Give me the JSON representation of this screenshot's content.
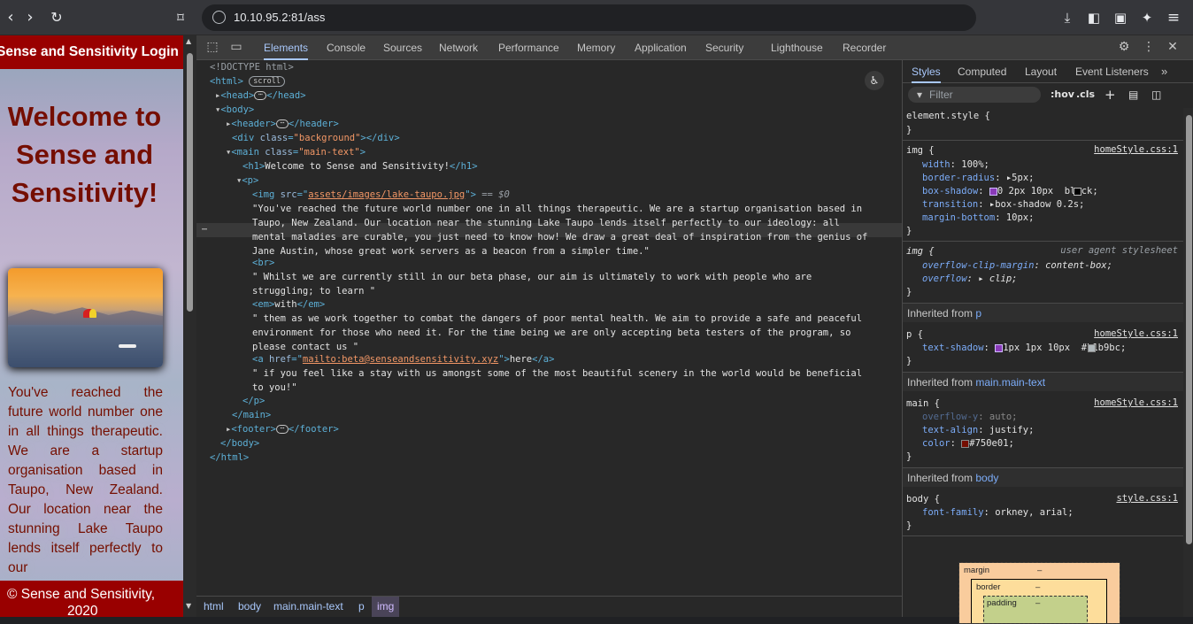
{
  "browser": {
    "url": "10.10.95.2:81/ass"
  },
  "page": {
    "header_title": "Sense and Sensitivity Login",
    "heading": "Welcome to Sense and Sensitivity!",
    "paragraph": "You've reached the future world number one in all things therapeutic. We are a startup organisation based in Taupo, New Zealand. Our location near the stunning Lake Taupo lends itself perfectly to our",
    "footer_line1": "© Sense and Sensitivity,",
    "footer_line2": "2020"
  },
  "devtools": {
    "tabs": [
      "Elements",
      "Console",
      "Sources",
      "Network",
      "Performance",
      "Memory",
      "Application",
      "Security",
      "Lighthouse",
      "Recorder"
    ],
    "dom": {
      "doctype": "<!DOCTYPE html>",
      "html_open": "<html>",
      "scroll_badge": "scroll",
      "head_open": "<head>",
      "head_close": "</head>",
      "body_open": "<body>",
      "header_open": "<header>",
      "header_close": "</header>",
      "div_open": "<div ",
      "div_attr": "class",
      "div_val": "\"background\"",
      "div_close": "></div>",
      "main_open": "<main ",
      "main_attr": "class",
      "main_val": "\"main-text\"",
      "h1_open": "<h1>",
      "h1_text": "Welcome to Sense and Sensitivity!",
      "h1_close": "</h1>",
      "p_open": "<p>",
      "img_open": "<img ",
      "img_attr": "src",
      "img_val": "assets/images/lake-taupo.jpg",
      "img_close": ">",
      "eq": " == $0",
      "text1": "\"You've reached the future world number one in all things therapeutic. We are a startup organisation based in\nTaupo, New Zealand. Our location near the stunning Lake Taupo lends itself perfectly to our ideology: all\nmental maladies are curable, you just need to know how! We draw a great deal of inspiration from the genius of\nJane Austin, whose great work servers as a beacon from a simpler time.\"",
      "br": "<br>",
      "text2": "\" Whilst we are currently still in our beta phase, our aim is ultimately to work with people who are\nstruggling; to learn \"",
      "em_open": "<em>",
      "em_text": "with",
      "em_close": "</em>",
      "text3": "\" them as we work together to combat the dangers of poor mental health. We aim to provide a safe and peaceful\nenvironment for those who need it. For the time being we are only accepting beta testers of the program, so\nplease contact us \"",
      "a_open": "<a ",
      "a_attr": "href",
      "a_val": "mailto:beta@senseandsensitivity.xyz",
      "a_text": "here",
      "a_close": "</a>",
      "text4": "\" if you feel like a stay with us amongst some of the most beautiful scenery in the world would be beneficial\nto you!\"",
      "p_close": "</p>",
      "main_close": "</main>",
      "footer_open": "<footer>",
      "footer_close": "</footer>",
      "body_close": "</body>",
      "html_close": "</html>"
    },
    "breadcrumbs": [
      "html",
      "body",
      "main.main-text",
      "p",
      "img"
    ],
    "styles": {
      "tabs": [
        "Styles",
        "Computed",
        "Layout",
        "Event Listeners"
      ],
      "filter_placeholder": "Filter",
      "hov": ":hov",
      "cls": ".cls",
      "element_style": "element.style {",
      "close_brace": "}",
      "img_rule": "img {",
      "img_source": "homeStyle.css:1",
      "img_props": [
        {
          "name": "width",
          "value": "100%;"
        },
        {
          "name": "border-radius",
          "value": "5px;"
        },
        {
          "name": "box-shadow",
          "value": "0 2px 10px  black;"
        },
        {
          "name": "transition",
          "value": "box-shadow 0.2s;"
        },
        {
          "name": "margin-bottom",
          "value": "10px;"
        }
      ],
      "ua_rule": "img {",
      "ua_label": "user agent stylesheet",
      "ua_props": [
        {
          "name": "overflow-clip-margin",
          "value": "content-box;"
        },
        {
          "name": "overflow",
          "value": "clip;"
        }
      ],
      "inherited_p_label": "Inherited from ",
      "inherited_p_target": "p",
      "p_rule": "p {",
      "p_source": "homeStyle.css:1",
      "p_prop_name": "text-shadow",
      "p_prop_value": "1px 1px 10px  #b1b9bc;",
      "inherited_main_label": "Inherited from ",
      "inherited_main_target": "main.main-text",
      "main_rule": "main {",
      "main_source": "homeStyle.css:1",
      "main_props": [
        {
          "name": "overflow-y",
          "value": "auto;"
        },
        {
          "name": "text-align",
          "value": "justify;"
        },
        {
          "name": "color",
          "value": "#750e01;"
        }
      ],
      "inherited_body_label": "Inherited from ",
      "inherited_body_target": "body",
      "body_rule": "body {",
      "body_source": "style.css:1",
      "body_prop_name": "font-family",
      "body_prop_value": "orkney, arial;",
      "boxmodel": {
        "margin": "margin",
        "border": "border",
        "padding": "padding",
        "dash": "–"
      }
    }
  },
  "colors": {
    "brand_red": "#990000",
    "text_color": "#750e01",
    "shadow_color": "#b1b9bc"
  }
}
